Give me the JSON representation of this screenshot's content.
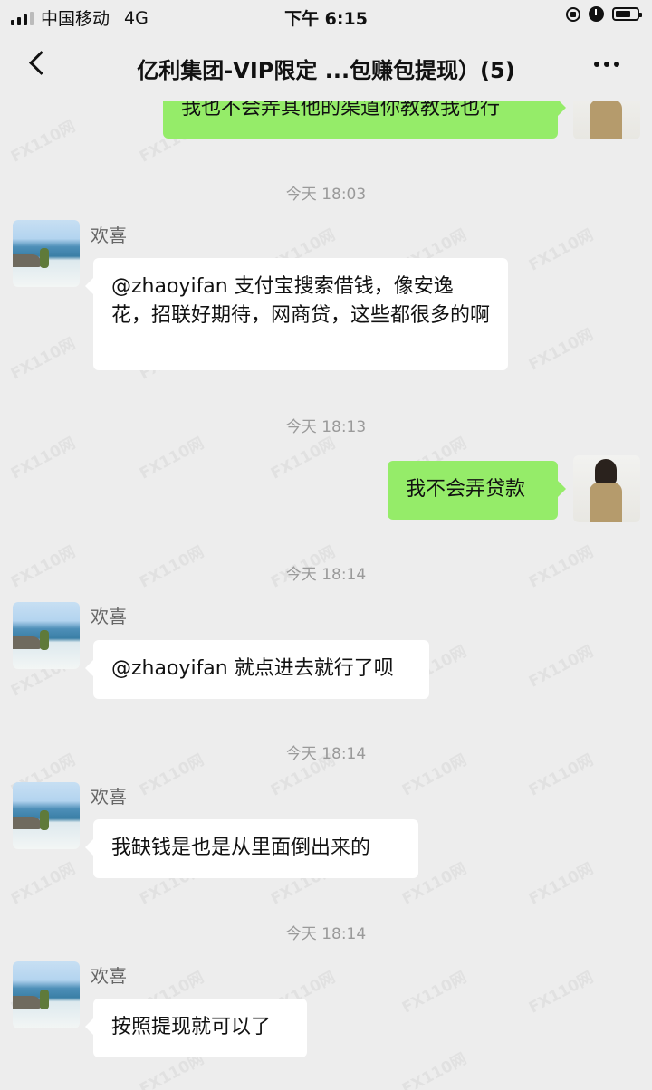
{
  "status_bar": {
    "carrier": "中国移动",
    "network": "4G",
    "time": "下午 6:15"
  },
  "nav": {
    "title": "亿利集团-VIP限定 ...包赚包提现）(5)",
    "back_icon": "chevron-left-icon",
    "more_icon": "more-dots-icon"
  },
  "messages": [
    {
      "side": "right",
      "text": "我也不会弄其他的渠道你教教我也行"
    },
    {
      "timestamp": "今天 18:03"
    },
    {
      "side": "left",
      "sender": "欢喜",
      "text": "@zhaoyifan 支付宝搜索借钱，像安逸花，招联好期待，网商贷，这些都很多的啊"
    },
    {
      "timestamp": "今天 18:13"
    },
    {
      "side": "right",
      "text": "我不会弄贷款"
    },
    {
      "timestamp": "今天 18:14"
    },
    {
      "side": "left",
      "sender": "欢喜",
      "text": "@zhaoyifan 就点进去就行了呗"
    },
    {
      "timestamp": "今天 18:14"
    },
    {
      "side": "left",
      "sender": "欢喜",
      "text": "我缺钱是也是从里面倒出来的"
    },
    {
      "timestamp": "今天 18:14"
    },
    {
      "side": "left",
      "sender": "欢喜",
      "text": "按照提现就可以了"
    }
  ],
  "watermark": "FX110网",
  "colors": {
    "background": "#ededed",
    "outgoing_bubble": "#95ec69",
    "incoming_bubble": "#ffffff",
    "timestamp_text": "#9a9a9a"
  }
}
